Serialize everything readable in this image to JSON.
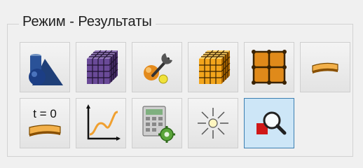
{
  "group": {
    "title": "Режим - Результаты"
  },
  "toolbar": {
    "buttons": [
      {
        "icon": "geometry-shapes-icon",
        "active": false
      },
      {
        "icon": "mesh-cube-purple-icon",
        "active": false
      },
      {
        "icon": "tools-wrench-icon",
        "active": false
      },
      {
        "icon": "mesh-cube-orange-icon",
        "active": false
      },
      {
        "icon": "grid-nodes-icon",
        "active": false
      },
      {
        "icon": "deformed-beam-icon",
        "active": false
      },
      {
        "icon": "time-zero-beam-icon",
        "active": false,
        "label": "t = 0"
      },
      {
        "icon": "xy-graph-icon",
        "active": false
      },
      {
        "icon": "calculator-gear-icon",
        "active": false
      },
      {
        "icon": "sun-light-icon",
        "active": false
      },
      {
        "icon": "magnifier-inspect-icon",
        "active": true
      }
    ]
  },
  "colors": {
    "active_bg": "#cde6f7",
    "active_border": "#3c7fb1",
    "button_border": "#cfcfcf",
    "panel_bg": "#f0f0f0"
  }
}
